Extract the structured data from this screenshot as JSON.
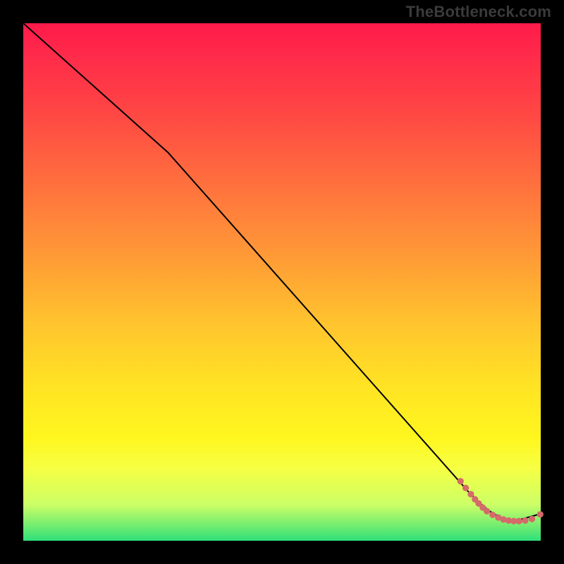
{
  "watermark": "TheBottleneck.com",
  "chart_data": {
    "type": "line",
    "title": "",
    "xlabel": "",
    "ylabel": "",
    "xlim": [
      0,
      100
    ],
    "ylim": [
      0,
      100
    ],
    "series": [
      {
        "name": "curve",
        "style": "line",
        "color": "#000000",
        "x": [
          0,
          28,
          86,
          88,
          90,
          92,
          93.5,
          95,
          100
        ],
        "y": [
          100,
          75,
          9.5,
          7.5,
          5.8,
          4.6,
          4.0,
          3.8,
          5.2
        ]
      },
      {
        "name": "markers",
        "style": "scatter",
        "color": "#d46a6a",
        "x": [
          84.5,
          85.5,
          86.5,
          87.3,
          88.0,
          88.8,
          89.6,
          90.7,
          91.8,
          92.8,
          93.8,
          94.8,
          95.8,
          97.0,
          98.3,
          99.9
        ],
        "y": [
          11.5,
          10.2,
          9.0,
          8.0,
          7.2,
          6.4,
          5.7,
          5.0,
          4.5,
          4.1,
          3.9,
          3.8,
          3.8,
          3.9,
          4.2,
          5.1
        ]
      }
    ]
  }
}
